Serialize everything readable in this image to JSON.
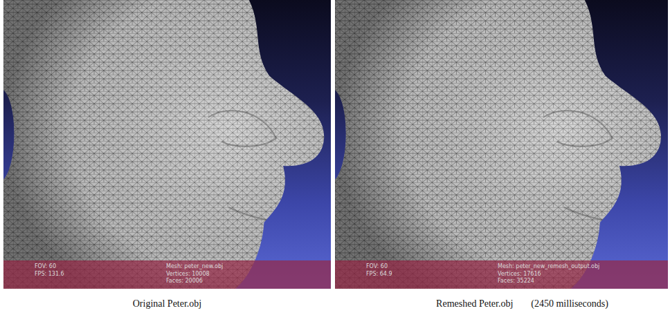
{
  "figure": {
    "panels": [
      {
        "caption": [
          "Original Peter.obj"
        ],
        "overlay": {
          "view": [
            "FOV: 60",
            "FPS: 131.6"
          ],
          "mesh": [
            "Mesh: peter_new.obj",
            "Vertices: 10008",
            "Faces: 20006"
          ]
        }
      },
      {
        "caption": [
          "Remeshed Peter.obj",
          "(2450 milliseconds)"
        ],
        "overlay": {
          "view": [
            "FOV: 60",
            "FPS: 64.9"
          ],
          "mesh": [
            "Mesh: peter_new_remesh_output.obj",
            "Vertices: 17616",
            "Faces: 35224"
          ]
        }
      }
    ]
  }
}
